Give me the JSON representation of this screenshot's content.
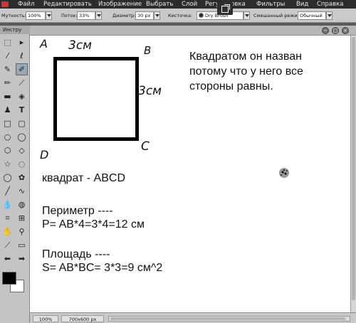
{
  "menu": {
    "items": [
      "Файл",
      "Редактировать",
      "Изображение",
      "Выбрать",
      "Слой",
      "Регулировка",
      "Фильтры",
      "Вид",
      "Справка"
    ]
  },
  "options": {
    "opacity_label": "Мутность:",
    "opacity_value": "100%",
    "flow_label": "Поток:",
    "flow_value": "33%",
    "diameter_label": "Диаметр:",
    "diameter_value": "30 px",
    "brush_label": "Кисточка:",
    "brush_value": "Dry Brush",
    "blend_label": "Смешанный режим:",
    "blend_value": "Обычный"
  },
  "tools": {
    "panel_title": "Инстру",
    "icons": [
      "marquee-icon",
      "move-icon",
      "wand-icon",
      "lasso-icon",
      "eyedropper-icon",
      "brush-icon",
      "pencil-icon",
      "clone-stamp-icon",
      "gradient-icon",
      "eraser-icon",
      "stamp-icon",
      "type-icon",
      "rectangle-icon",
      "rounded-rect-icon",
      "ellipse-icon",
      "circle-icon",
      "polygon-icon",
      "lasso-shape-icon",
      "star-icon",
      "custom-shape-icon",
      "speech-icon",
      "flower-icon",
      "line-icon",
      "bezier-icon",
      "drop-icon",
      "smudge-icon",
      "crop-icon",
      "transform-icon",
      "hand-icon",
      "zoom-icon",
      "picker-icon",
      "fill-icon",
      "arrow-left-icon",
      "arrow-right-icon"
    ]
  },
  "canvas": {
    "corner_a": "A",
    "corner_b": "B",
    "corner_c": "C",
    "corner_d": "D",
    "side_top": "3см",
    "side_right": "3см",
    "explanation_line1": "Квадратом он назван",
    "explanation_line2": "потому что у него все",
    "explanation_line3": "стороны равны.",
    "square_name": "квадрат - ABCD",
    "perimeter_title": "Периметр ----",
    "perimeter_formula": "P= AB*4=3*4=12 см",
    "area_title": "Площадь ----",
    "area_formula": "S= AB*BC= 3*3=9 см^2"
  },
  "status": {
    "zoom": "100%",
    "size": "700x600 px"
  },
  "colors": {
    "foreground": "#000000",
    "background": "#ffffff"
  }
}
